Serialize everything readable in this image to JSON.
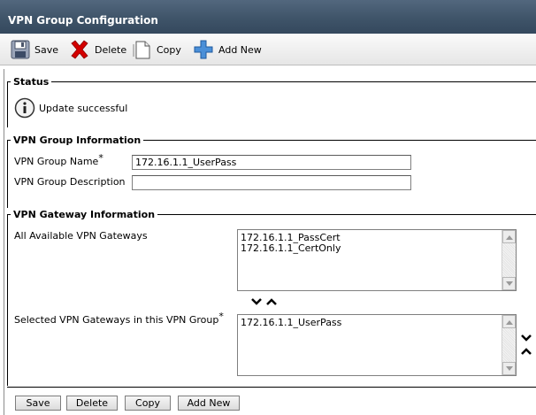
{
  "window": {
    "title": "VPN Group Configuration"
  },
  "toolbar": {
    "save_label": "Save",
    "delete_label": "Delete",
    "copy_label": "Copy",
    "add_new_label": "Add New"
  },
  "status": {
    "legend": "Status",
    "message": "Update successful"
  },
  "group_info": {
    "legend": "VPN Group Information",
    "name_label": "VPN Group Name",
    "name_value": "172.16.1.1_UserPass",
    "description_label": "VPN Group Description",
    "description_value": "",
    "required_mark": "*"
  },
  "gateway_info": {
    "legend": "VPN Gateway Information",
    "available_label": "All Available VPN Gateways",
    "available_items": [
      "172.16.1.1_PassCert",
      "172.16.1.1_CertOnly"
    ],
    "selected_label": "Selected VPN Gateways in this VPN Group",
    "selected_items": [
      "172.16.1.1_UserPass"
    ],
    "required_mark": "*"
  },
  "bottom_buttons": {
    "save_label": "Save",
    "delete_label": "Delete",
    "copy_label": "Copy",
    "add_new_label": "Add New"
  },
  "colors": {
    "titlebar": "#3f5469",
    "delete_red": "#d40000",
    "add_blue": "#4a8fd8"
  }
}
